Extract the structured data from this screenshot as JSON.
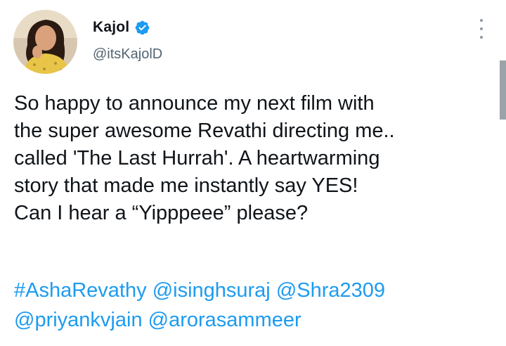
{
  "author": {
    "display_name": "Kajol",
    "handle": "@itsKajolD",
    "verified_icon": "verified-badge-icon",
    "avatar_icon": "profile-photo"
  },
  "menu": {
    "icon": "more-options-icon"
  },
  "tweet": {
    "lines": [
      "So happy to announce my next film with",
      "the super awesome Revathi directing me..",
      "called 'The Last Hurrah'. A heartwarming",
      "story that made me instantly say YES!",
      "Can I hear a “Yipppeee” please?"
    ],
    "tags": {
      "hashtag": "#AshaRevathy",
      "mention_1": "@isinghsuraj",
      "mention_2": "@Shra2309",
      "mention_3": "@priyankvjain",
      "mention_4": "@arorasammeer"
    }
  },
  "colors": {
    "link": "#1d9bf0",
    "verified": "#1d9bf0",
    "text": "#0f1419",
    "secondary": "#536471"
  }
}
